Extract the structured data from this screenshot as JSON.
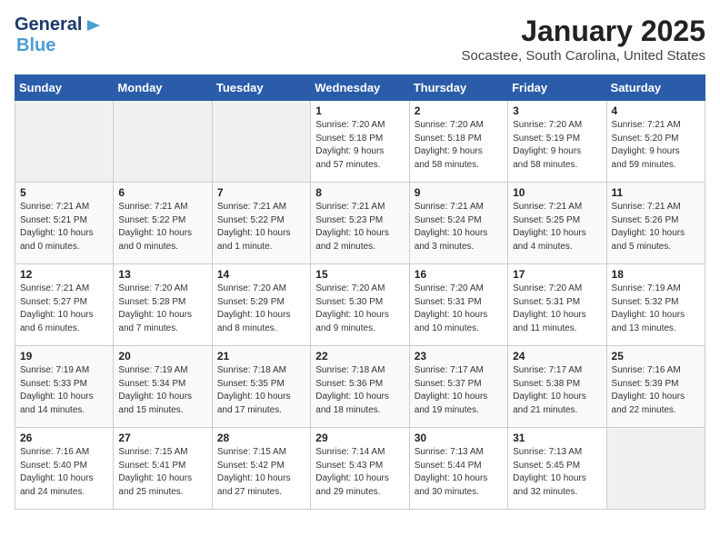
{
  "logo": {
    "line1": "General",
    "line2": "Blue"
  },
  "title": "January 2025",
  "location": "Socastee, South Carolina, United States",
  "days_of_week": [
    "Sunday",
    "Monday",
    "Tuesday",
    "Wednesday",
    "Thursday",
    "Friday",
    "Saturday"
  ],
  "weeks": [
    [
      {
        "num": "",
        "info": ""
      },
      {
        "num": "",
        "info": ""
      },
      {
        "num": "",
        "info": ""
      },
      {
        "num": "1",
        "info": "Sunrise: 7:20 AM\nSunset: 5:18 PM\nDaylight: 9 hours\nand 57 minutes."
      },
      {
        "num": "2",
        "info": "Sunrise: 7:20 AM\nSunset: 5:18 PM\nDaylight: 9 hours\nand 58 minutes."
      },
      {
        "num": "3",
        "info": "Sunrise: 7:20 AM\nSunset: 5:19 PM\nDaylight: 9 hours\nand 58 minutes."
      },
      {
        "num": "4",
        "info": "Sunrise: 7:21 AM\nSunset: 5:20 PM\nDaylight: 9 hours\nand 59 minutes."
      }
    ],
    [
      {
        "num": "5",
        "info": "Sunrise: 7:21 AM\nSunset: 5:21 PM\nDaylight: 10 hours\nand 0 minutes."
      },
      {
        "num": "6",
        "info": "Sunrise: 7:21 AM\nSunset: 5:22 PM\nDaylight: 10 hours\nand 0 minutes."
      },
      {
        "num": "7",
        "info": "Sunrise: 7:21 AM\nSunset: 5:22 PM\nDaylight: 10 hours\nand 1 minute."
      },
      {
        "num": "8",
        "info": "Sunrise: 7:21 AM\nSunset: 5:23 PM\nDaylight: 10 hours\nand 2 minutes."
      },
      {
        "num": "9",
        "info": "Sunrise: 7:21 AM\nSunset: 5:24 PM\nDaylight: 10 hours\nand 3 minutes."
      },
      {
        "num": "10",
        "info": "Sunrise: 7:21 AM\nSunset: 5:25 PM\nDaylight: 10 hours\nand 4 minutes."
      },
      {
        "num": "11",
        "info": "Sunrise: 7:21 AM\nSunset: 5:26 PM\nDaylight: 10 hours\nand 5 minutes."
      }
    ],
    [
      {
        "num": "12",
        "info": "Sunrise: 7:21 AM\nSunset: 5:27 PM\nDaylight: 10 hours\nand 6 minutes."
      },
      {
        "num": "13",
        "info": "Sunrise: 7:20 AM\nSunset: 5:28 PM\nDaylight: 10 hours\nand 7 minutes."
      },
      {
        "num": "14",
        "info": "Sunrise: 7:20 AM\nSunset: 5:29 PM\nDaylight: 10 hours\nand 8 minutes."
      },
      {
        "num": "15",
        "info": "Sunrise: 7:20 AM\nSunset: 5:30 PM\nDaylight: 10 hours\nand 9 minutes."
      },
      {
        "num": "16",
        "info": "Sunrise: 7:20 AM\nSunset: 5:31 PM\nDaylight: 10 hours\nand 10 minutes."
      },
      {
        "num": "17",
        "info": "Sunrise: 7:20 AM\nSunset: 5:31 PM\nDaylight: 10 hours\nand 11 minutes."
      },
      {
        "num": "18",
        "info": "Sunrise: 7:19 AM\nSunset: 5:32 PM\nDaylight: 10 hours\nand 13 minutes."
      }
    ],
    [
      {
        "num": "19",
        "info": "Sunrise: 7:19 AM\nSunset: 5:33 PM\nDaylight: 10 hours\nand 14 minutes."
      },
      {
        "num": "20",
        "info": "Sunrise: 7:19 AM\nSunset: 5:34 PM\nDaylight: 10 hours\nand 15 minutes."
      },
      {
        "num": "21",
        "info": "Sunrise: 7:18 AM\nSunset: 5:35 PM\nDaylight: 10 hours\nand 17 minutes."
      },
      {
        "num": "22",
        "info": "Sunrise: 7:18 AM\nSunset: 5:36 PM\nDaylight: 10 hours\nand 18 minutes."
      },
      {
        "num": "23",
        "info": "Sunrise: 7:17 AM\nSunset: 5:37 PM\nDaylight: 10 hours\nand 19 minutes."
      },
      {
        "num": "24",
        "info": "Sunrise: 7:17 AM\nSunset: 5:38 PM\nDaylight: 10 hours\nand 21 minutes."
      },
      {
        "num": "25",
        "info": "Sunrise: 7:16 AM\nSunset: 5:39 PM\nDaylight: 10 hours\nand 22 minutes."
      }
    ],
    [
      {
        "num": "26",
        "info": "Sunrise: 7:16 AM\nSunset: 5:40 PM\nDaylight: 10 hours\nand 24 minutes."
      },
      {
        "num": "27",
        "info": "Sunrise: 7:15 AM\nSunset: 5:41 PM\nDaylight: 10 hours\nand 25 minutes."
      },
      {
        "num": "28",
        "info": "Sunrise: 7:15 AM\nSunset: 5:42 PM\nDaylight: 10 hours\nand 27 minutes."
      },
      {
        "num": "29",
        "info": "Sunrise: 7:14 AM\nSunset: 5:43 PM\nDaylight: 10 hours\nand 29 minutes."
      },
      {
        "num": "30",
        "info": "Sunrise: 7:13 AM\nSunset: 5:44 PM\nDaylight: 10 hours\nand 30 minutes."
      },
      {
        "num": "31",
        "info": "Sunrise: 7:13 AM\nSunset: 5:45 PM\nDaylight: 10 hours\nand 32 minutes."
      },
      {
        "num": "",
        "info": ""
      }
    ]
  ]
}
